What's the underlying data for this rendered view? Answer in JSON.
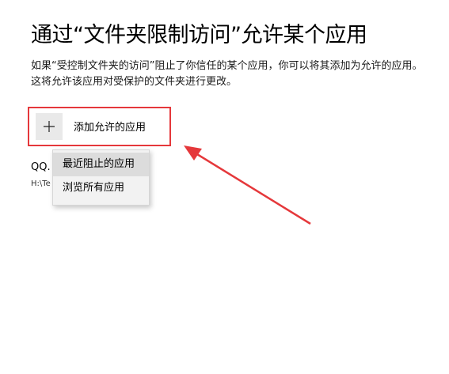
{
  "title": "通过“文件夹限制访问”允许某个应用",
  "description": "如果“受控制文件夹的访问”阻止了你信任的某个应用，你可以将其添加为允许的应用。这将允许该应用对受保护的文件夹进行更改。",
  "add_button": {
    "label": "添加允许的应用",
    "icon": "plus-icon"
  },
  "allowed_app": {
    "name": "QQ.",
    "path": "H:\\Te"
  },
  "menu": {
    "items": [
      {
        "label": "最近阻止的应用"
      },
      {
        "label": "浏览所有应用"
      }
    ]
  },
  "colors": {
    "annotation": "#e5383b",
    "plus_box_bg": "#e9e9e9",
    "menu_bg": "#f2f2f2",
    "menu_hover": "#dcdcdc"
  }
}
